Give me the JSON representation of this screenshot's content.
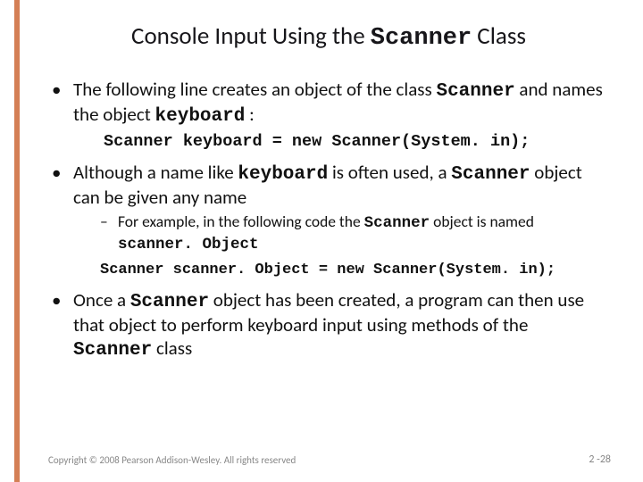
{
  "title": {
    "pre": "Console Input Using the ",
    "code": "Scanner",
    "post": " Class"
  },
  "bullets": [
    {
      "segments": [
        {
          "t": "text",
          "v": "The following line creates an object of the class "
        },
        {
          "t": "code",
          "v": "Scanner"
        },
        {
          "t": "text",
          "v": " and names the object "
        },
        {
          "t": "code",
          "v": "keyboard"
        },
        {
          "t": "text",
          "v": " :"
        }
      ],
      "code": "Scanner keyboard = new Scanner(System. in);"
    },
    {
      "segments": [
        {
          "t": "text",
          "v": "Although a name like "
        },
        {
          "t": "code",
          "v": "keyboard"
        },
        {
          "t": "text",
          "v": " is often used, a "
        },
        {
          "t": "code",
          "v": "Scanner"
        },
        {
          "t": "text",
          "v": " object can be given any name"
        }
      ],
      "sub": {
        "segments": [
          {
            "t": "text",
            "v": "For example, in the following code the "
          },
          {
            "t": "code",
            "v": "Scanner"
          },
          {
            "t": "text",
            "v": " object is named "
          },
          {
            "t": "code",
            "v": "scanner. Object"
          }
        ],
        "code": "Scanner scanner. Object = new Scanner(System. in);"
      }
    },
    {
      "segments": [
        {
          "t": "text",
          "v": "Once a "
        },
        {
          "t": "code",
          "v": "Scanner"
        },
        {
          "t": "text",
          "v": " object has been created, a program can then use that object to perform keyboard input using methods of the "
        },
        {
          "t": "code",
          "v": "Scanner"
        },
        {
          "t": "text",
          "v": " class"
        }
      ]
    }
  ],
  "footer": "Copyright © 2008 Pearson Addison-Wesley. All rights reserved",
  "pagenum": "2 -28"
}
